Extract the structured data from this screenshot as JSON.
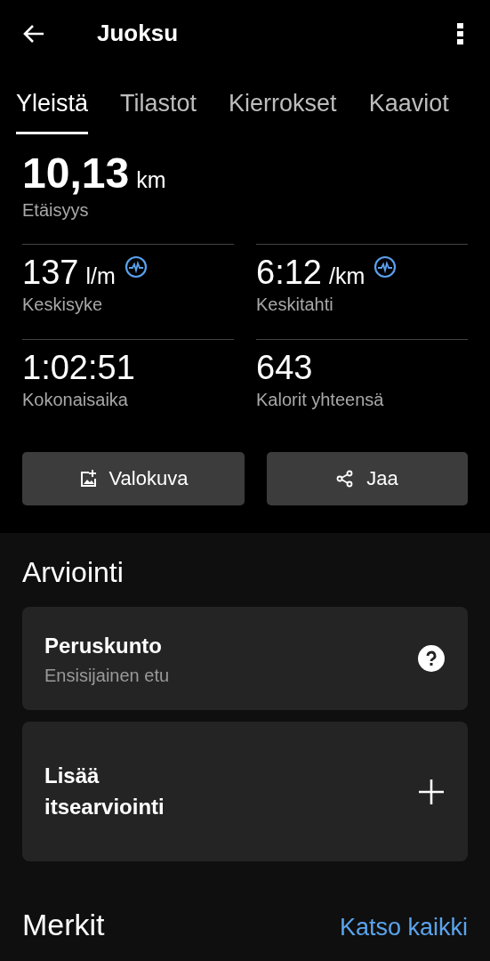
{
  "app_bar": {
    "title": "Juoksu"
  },
  "tabs": [
    {
      "label": "Yleistä",
      "selected": true
    },
    {
      "label": "Tilastot",
      "selected": false
    },
    {
      "label": "Kierrokset",
      "selected": false
    },
    {
      "label": "Kaaviot",
      "selected": false
    }
  ],
  "main_stat": {
    "value": "10,13",
    "unit": "km",
    "label": "Etäisyys"
  },
  "stats": [
    {
      "value": "137",
      "unit": "l/m",
      "label": "Keskisyke",
      "chart_icon": true
    },
    {
      "value": "6:12",
      "unit": "/km",
      "label": "Keskitahti",
      "chart_icon": true
    },
    {
      "value": "1:02:51",
      "label": "Kokonaisaika",
      "chart_icon": false
    },
    {
      "value": "643",
      "label": "Kalorit yhteensä",
      "chart_icon": false
    }
  ],
  "buttons": [
    {
      "kind": "photo",
      "label": "Valokuva"
    },
    {
      "kind": "share",
      "label": "Jaa"
    }
  ],
  "evaluation": {
    "heading": "Arviointi",
    "cards": [
      {
        "kind": "info",
        "title": "Peruskunto",
        "subtitle": "Ensisijainen etu"
      },
      {
        "kind": "add",
        "title": "Lisää itsearviointi"
      }
    ]
  },
  "badges": {
    "heading": "Merkit",
    "link": "Katso kaikki"
  }
}
